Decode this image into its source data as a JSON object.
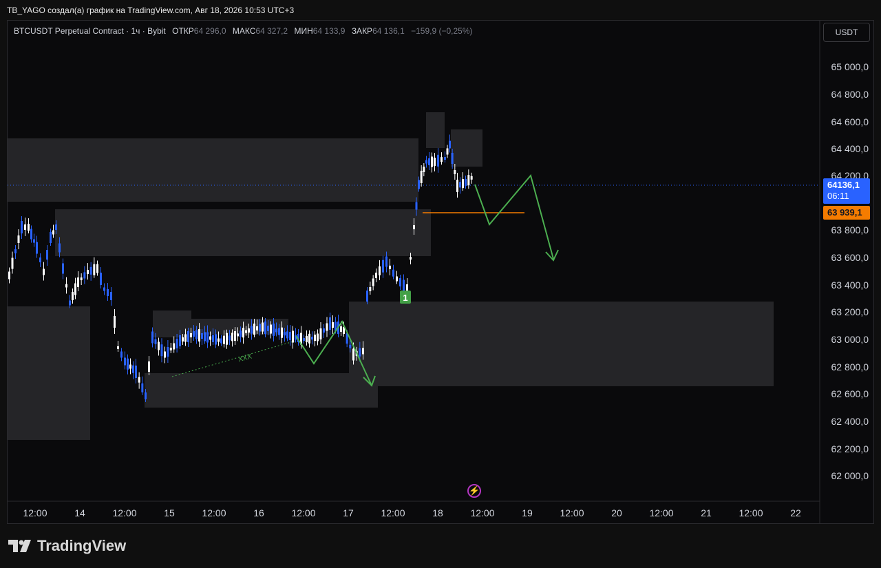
{
  "caption": "TB_YAGO создал(а) график на TradingView.com, Авг 18, 2026 10:53 UTC+3",
  "legend": {
    "symbol": "BTCUSDT Perpetual Contract · 1ч · Bybit",
    "open_label": "ОТКР",
    "open": "64 296,0",
    "high_label": "МАКС",
    "high": "64 327,2",
    "low_label": "МИН",
    "low": "64 133,9",
    "close_label": "ЗАКР",
    "close": "64 136,1",
    "change": "−159,9 (−0,25%)"
  },
  "currency": "USDT",
  "price_axis": [
    "65 000,0",
    "64 800,0",
    "64 600,0",
    "64 400,0",
    "64 200,0",
    "63 800,0",
    "63 600,0",
    "63 400,0",
    "63 200,0",
    "63 000,0",
    "62 800,0",
    "62 600,0",
    "62 400,0",
    "62 200,0",
    "62 000,0"
  ],
  "last_price": {
    "price": "64136,1",
    "countdown": "06:11"
  },
  "level_price": "63 939,1",
  "time_axis": [
    "12:00",
    "14",
    "12:00",
    "15",
    "12:00",
    "16",
    "12:00",
    "17",
    "12:00",
    "18",
    "12:00",
    "19",
    "12:00",
    "20",
    "12:00",
    "21",
    "12:00",
    "22"
  ],
  "annotations": {
    "marker": "1",
    "trendline_label": "XXX"
  },
  "colors": {
    "bull": "#ffffff",
    "bear": "#2962ff",
    "zone": "#2a2a2e",
    "projection": "#4caf50",
    "level": "#f57c00"
  },
  "logo": "TradingView"
}
